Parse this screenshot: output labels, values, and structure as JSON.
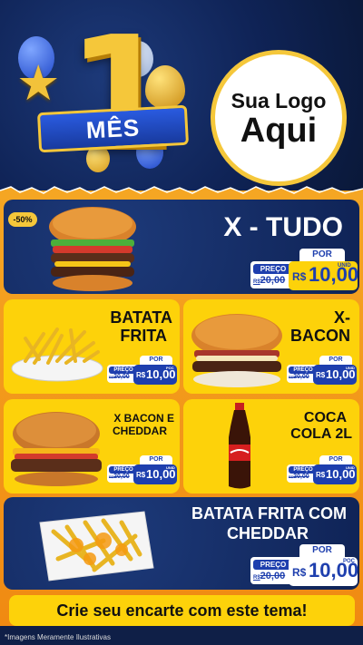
{
  "header": {
    "badge_number": "1",
    "ribbon_text": "MÊS",
    "logo_line1": "Sua Logo",
    "logo_line2": "Aqui"
  },
  "discount_badge": "-50%",
  "price_common": {
    "por": "POR",
    "preco": "PREÇO",
    "currency": "R$",
    "old_value": "20,00",
    "old_prefix": "R$"
  },
  "items": [
    {
      "title": "X - TUDO",
      "new_value": "10,00",
      "unit": "UNID"
    },
    {
      "title_line1": "BATATA",
      "title_line2": "FRITA",
      "new_value": "10,00",
      "unit": "POC"
    },
    {
      "title_line1": "X-",
      "title_line2": "BACON",
      "new_value": "10,00",
      "unit": "UNID"
    },
    {
      "title_line1": "X BACON E",
      "title_line2": "CHEDDAR",
      "new_value": "10,00",
      "unit": "UNID"
    },
    {
      "title_line1": "COCA",
      "title_line2": "COLA 2L",
      "new_value": "10,00",
      "unit": "UNID"
    },
    {
      "title_line1": "BATATA FRITA COM",
      "title_line2": "CHEDDAR",
      "new_value": "10,00",
      "unit": "POÇ"
    }
  ],
  "footer": "Crie seu encarte com este tema!",
  "disclaimer": "*Imagens Meramente Ilustrativas",
  "colors": {
    "navy": "#0f2356",
    "yellow": "#fdd20a",
    "orange": "#f5a623",
    "blue": "#1e3fae"
  }
}
